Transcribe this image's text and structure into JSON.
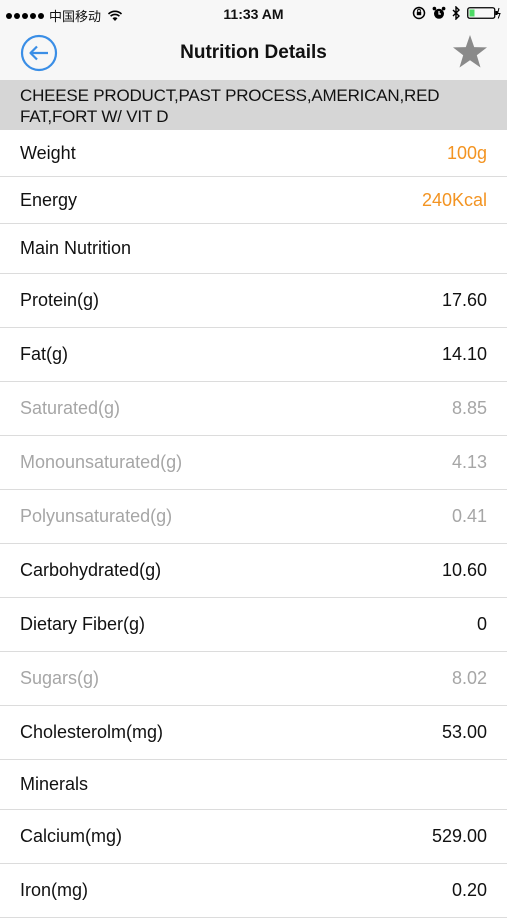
{
  "status_bar": {
    "carrier": "中国移动",
    "time": "11:33 AM"
  },
  "nav": {
    "title": "Nutrition Details"
  },
  "food": {
    "name": "CHEESE PRODUCT,PAST PROCESS,AMERICAN,RED FAT,FORT W/ VIT D"
  },
  "summary": {
    "weight_label": "Weight",
    "weight_value": "100g",
    "energy_label": "Energy",
    "energy_value": "240Kcal"
  },
  "sections": {
    "main_nutrition": "Main Nutrition",
    "minerals": "Minerals"
  },
  "nutrients": [
    {
      "label": "Protein(g)",
      "value": "17.60"
    },
    {
      "label": "Fat(g)",
      "value": "14.10"
    },
    {
      "label": "Saturated(g)",
      "value": "8.85"
    },
    {
      "label": "Monounsaturated(g)",
      "value": "4.13"
    },
    {
      "label": "Polyunsaturated(g)",
      "value": "0.41"
    },
    {
      "label": "Carbohydrated(g)",
      "value": "10.60"
    },
    {
      "label": "Dietary Fiber(g)",
      "value": "0"
    },
    {
      "label": "Sugars(g)",
      "value": "8.02"
    },
    {
      "label": "Cholesterolm(mg)",
      "value": "53.00"
    }
  ],
  "minerals": [
    {
      "label": "Calcium(mg)",
      "value": "529.00"
    },
    {
      "label": "Iron(mg)",
      "value": "0.20"
    }
  ],
  "colors": {
    "accent_blue": "#3a8ee6",
    "highlight_orange": "#f39422",
    "muted_gray": "#a6a6a6",
    "header_gray": "#d6d6d6"
  },
  "icons": {
    "back": "back-arrow-circle-icon",
    "favorite": "star-icon",
    "wifi": "wifi-icon",
    "alarm": "alarm-icon",
    "bluetooth": "bluetooth-icon",
    "battery": "battery-icon",
    "orientation_lock": "orientation-lock-icon"
  }
}
